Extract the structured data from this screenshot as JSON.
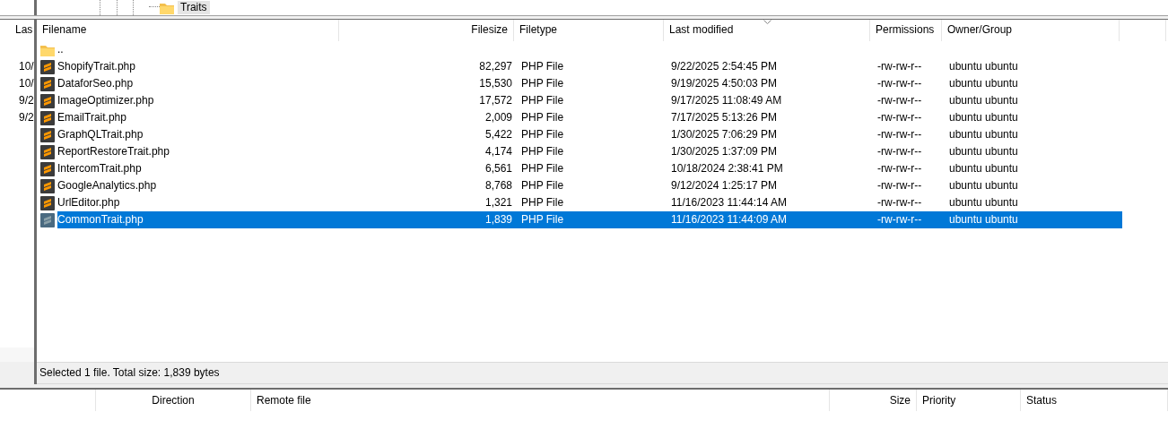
{
  "tree": {
    "item": "Traits"
  },
  "left_pane": {
    "column": "Las",
    "cells": [
      "10/",
      "10/",
      "9/2",
      "9/2"
    ]
  },
  "file_list": {
    "columns": [
      {
        "label": "Filename",
        "sorted": false
      },
      {
        "label": "Filesize",
        "sorted": false
      },
      {
        "label": "Filetype",
        "sorted": false
      },
      {
        "label": "Last modified",
        "sorted": true
      },
      {
        "label": "Permissions",
        "sorted": false
      },
      {
        "label": "Owner/Group",
        "sorted": false
      }
    ],
    "rows": [
      {
        "kind": "parent",
        "name": "..",
        "selected": false
      },
      {
        "kind": "php",
        "name": "ShopifyTrait.php",
        "size": "82,297",
        "type": "PHP File",
        "modified": "9/22/2025 2:54:45 PM",
        "permissions": "-rw-rw-r--",
        "owner": "ubuntu ubuntu",
        "selected": false
      },
      {
        "kind": "php",
        "name": "DataforSeo.php",
        "size": "15,530",
        "type": "PHP File",
        "modified": "9/19/2025 4:50:03 PM",
        "permissions": "-rw-rw-r--",
        "owner": "ubuntu ubuntu",
        "selected": false
      },
      {
        "kind": "php",
        "name": "ImageOptimizer.php",
        "size": "17,572",
        "type": "PHP File",
        "modified": "9/17/2025 11:08:49 AM",
        "permissions": "-rw-rw-r--",
        "owner": "ubuntu ubuntu",
        "selected": false
      },
      {
        "kind": "php",
        "name": "EmailTrait.php",
        "size": "2,009",
        "type": "PHP File",
        "modified": "7/17/2025 5:13:26 PM",
        "permissions": "-rw-rw-r--",
        "owner": "ubuntu ubuntu",
        "selected": false
      },
      {
        "kind": "php",
        "name": "GraphQLTrait.php",
        "size": "5,422",
        "type": "PHP File",
        "modified": "1/30/2025 7:06:29 PM",
        "permissions": "-rw-rw-r--",
        "owner": "ubuntu ubuntu",
        "selected": false
      },
      {
        "kind": "php",
        "name": "ReportRestoreTrait.php",
        "size": "4,174",
        "type": "PHP File",
        "modified": "1/30/2025 1:37:09 PM",
        "permissions": "-rw-rw-r--",
        "owner": "ubuntu ubuntu",
        "selected": false
      },
      {
        "kind": "php",
        "name": "IntercomTrait.php",
        "size": "6,561",
        "type": "PHP File",
        "modified": "10/18/2024 2:38:41 PM",
        "permissions": "-rw-rw-r--",
        "owner": "ubuntu ubuntu",
        "selected": false
      },
      {
        "kind": "php",
        "name": "GoogleAnalytics.php",
        "size": "8,768",
        "type": "PHP File",
        "modified": "9/12/2024 1:25:17 PM",
        "permissions": "-rw-rw-r--",
        "owner": "ubuntu ubuntu",
        "selected": false
      },
      {
        "kind": "php",
        "name": "UrlEditor.php",
        "size": "1,321",
        "type": "PHP File",
        "modified": "11/16/2023 11:44:14 AM",
        "permissions": "-rw-rw-r--",
        "owner": "ubuntu ubuntu",
        "selected": false
      },
      {
        "kind": "php",
        "name": "CommonTrait.php",
        "size": "1,839",
        "type": "PHP File",
        "modified": "11/16/2023 11:44:09 AM",
        "permissions": "-rw-rw-r--",
        "owner": "ubuntu ubuntu",
        "selected": true
      }
    ]
  },
  "status_bar": "Selected 1 file. Total size: 1,839 bytes",
  "queue": {
    "columns": [
      "Direction",
      "Remote file",
      "Size",
      "Priority",
      "Status"
    ]
  }
}
